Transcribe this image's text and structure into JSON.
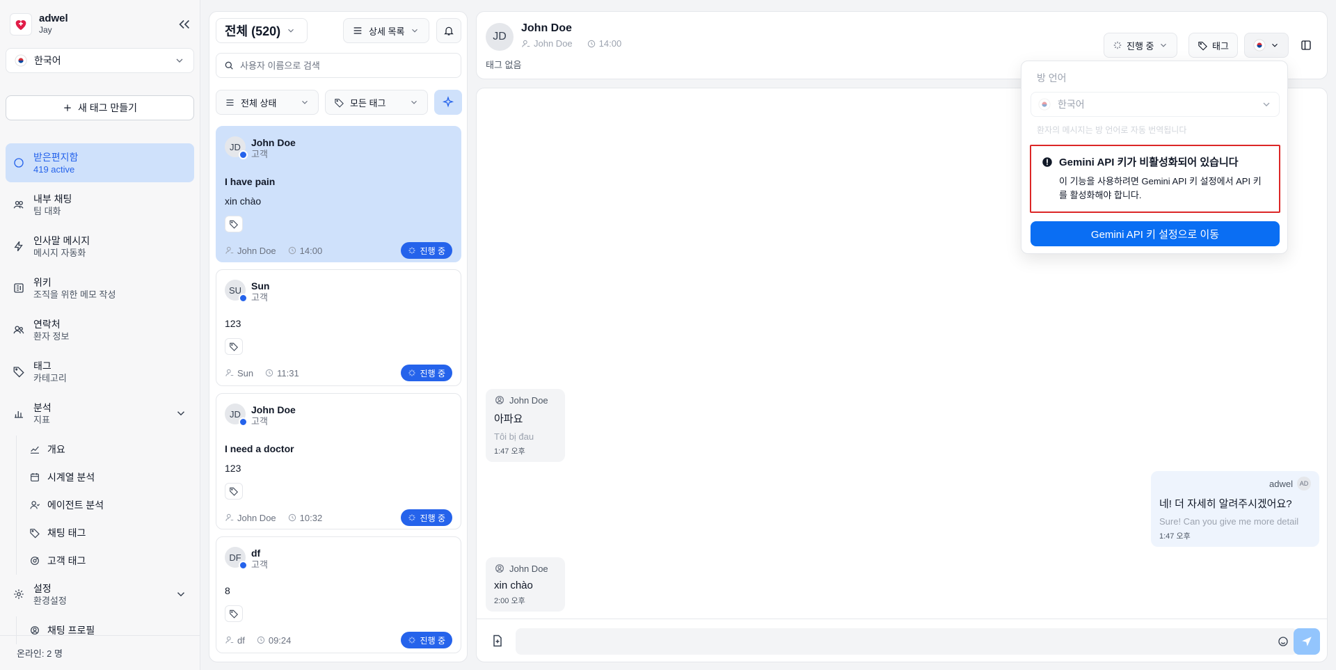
{
  "brand": {
    "name": "adwel",
    "user": "Jay"
  },
  "sidebar": {
    "language": "한국어",
    "new_tag_label": "새 태그 만들기",
    "items": [
      {
        "title": "받은편지함",
        "sub": "419 active"
      },
      {
        "title": "내부 채팅",
        "sub": "팀 대화"
      },
      {
        "title": "인사말 메시지",
        "sub": "메시지 자동화"
      },
      {
        "title": "위키",
        "sub": "조직을 위한 메모 작성"
      },
      {
        "title": "연락처",
        "sub": "환자 정보"
      },
      {
        "title": "태그",
        "sub": "카테고리"
      },
      {
        "title": "분석",
        "sub": "지표"
      },
      {
        "title": "설정",
        "sub": "환경설정"
      }
    ],
    "analytics_sub": [
      "개요",
      "시계열 분석",
      "에이전트 분석",
      "채팅 태그",
      "고객 태그"
    ],
    "settings_sub": [
      "채팅 프로필"
    ],
    "online": "온라인:  2 명"
  },
  "list": {
    "filter_label": "전체 (520)",
    "view_label": "상세 목록",
    "search_placeholder": "사용자 이름으로 검색",
    "status_filter": "전체 상태",
    "tag_filter": "모든 태그",
    "cards": [
      {
        "initials": "JD",
        "name": "John Doe",
        "role": "고객",
        "line1": "I have pain",
        "line2": "xin chào",
        "agent": "John Doe",
        "time": "14:00",
        "status": "진행 중"
      },
      {
        "initials": "SU",
        "name": "Sun",
        "role": "고객",
        "line1": "",
        "line2": "123",
        "agent": "Sun",
        "time": "11:31",
        "status": "진행 중"
      },
      {
        "initials": "JD",
        "name": "John Doe",
        "role": "고객",
        "line1": "I need a doctor",
        "line2": "123",
        "agent": "John Doe",
        "time": "10:32",
        "status": "진행 중"
      },
      {
        "initials": "DF",
        "name": "df",
        "role": "고객",
        "line1": "",
        "line2": "8",
        "agent": "df",
        "time": "09:24",
        "status": "진행 중"
      }
    ]
  },
  "chat": {
    "initials": "JD",
    "name": "John Doe",
    "agent": "John Doe",
    "time": "14:00",
    "no_tags": "태그 없음",
    "status_label": "진행 중",
    "tag_label": "태그",
    "messages": [
      {
        "sender": "John Doe",
        "text": "아파요",
        "translation": "Tôi bị đau",
        "time": "1:47 오후"
      },
      {
        "sender": "adwel",
        "avatar": "AD",
        "text": "네! 더 자세히 알려주시겠어요?",
        "translation": "Sure! Can you give me more detail",
        "time": "1:47 오후"
      },
      {
        "sender": "John Doe",
        "text": "xin chào",
        "time": "2:00 오후"
      }
    ]
  },
  "popover": {
    "label": "방 언어",
    "language": "한국어",
    "hint": "환자의 메시지는 방 언어로 자동 번역됩니다",
    "alert_title": "Gemini API 키가 비활성화되어 있습니다",
    "alert_text": "이 기능을 사용하려면 Gemini API 키 설정에서 API 키를 활성화해야 합니다.",
    "button": "Gemini API 키 설정으로 이동"
  },
  "colors": {
    "accent": "#0a6ef3",
    "active_bg": "#cfe1fb",
    "alert_border": "#dc2626"
  }
}
